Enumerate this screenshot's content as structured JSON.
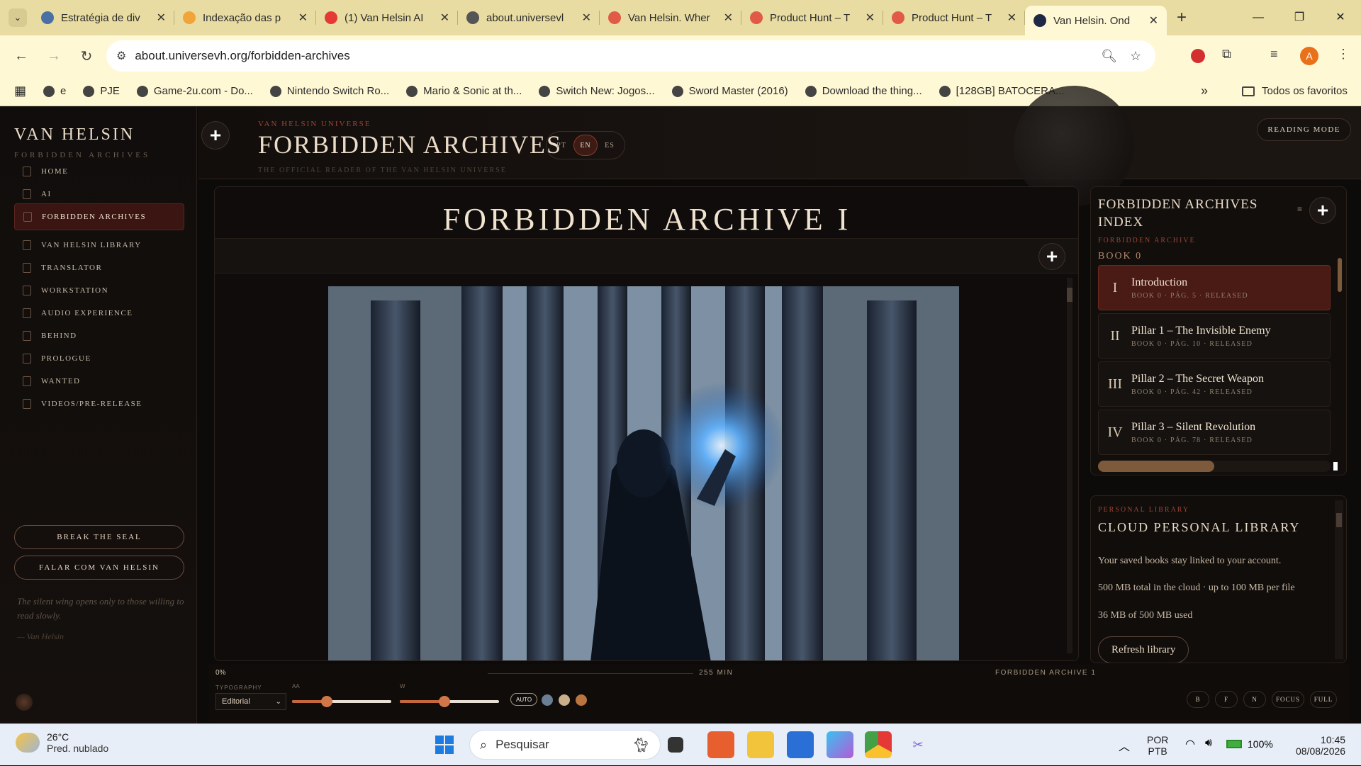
{
  "browser": {
    "tabs": [
      {
        "title": "Estratégia de div",
        "icon": "settings-globe-icon",
        "color": "#4a6fa5"
      },
      {
        "title": "Indexação das p",
        "icon": "analytics-icon",
        "color": "#f2a33a"
      },
      {
        "title": "(1) Van Helsin AI",
        "icon": "youtube-icon",
        "color": "#e53935"
      },
      {
        "title": "about.universevl",
        "icon": "globe-icon",
        "color": "#555555"
      },
      {
        "title": "Van Helsin. Wher",
        "icon": "producthunt-icon",
        "color": "#e05a47"
      },
      {
        "title": "Product Hunt – T",
        "icon": "producthunt-icon",
        "color": "#e05a47"
      },
      {
        "title": "Product Hunt – T",
        "icon": "producthunt-icon",
        "color": "#e05a47"
      },
      {
        "title": "Van Helsin. Ond",
        "icon": "vanhelsin-icon",
        "color": "#1e2a44"
      }
    ],
    "active_tab": 7,
    "url": "about.universevh.org/forbidden-archives",
    "bookmarks": [
      "e",
      "PJE",
      "Game-2u.com - Do...",
      "Nintendo Switch Ro...",
      "Mario & Sonic at th...",
      "Switch New: Jogos...",
      "Sword Master (2016)",
      "Download the thing...",
      "[128GB] BATOCERA..."
    ],
    "all_bookmarks": "Todos os favoritos",
    "profile_initial": "A"
  },
  "sidebar": {
    "brand": "VAN HELSIN",
    "brand_sub": "FORBIDDEN ARCHIVES",
    "items": [
      "HOME",
      "AI",
      "FORBIDDEN ARCHIVES",
      "VAN HELSIN LIBRARY",
      "TRANSLATOR",
      "WORKSTATION",
      "AUDIO EXPERIENCE",
      "BEHIND",
      "PROLOGUE",
      "WANTED",
      "VIDEOS/PRE-RELEASE"
    ],
    "active_index": 2,
    "btn_seal": "BREAK THE SEAL",
    "btn_talk": "FALAR COM VAN HELSIN",
    "quote": "The silent wing opens only to those willing to read slowly.",
    "quote_author": "— Van Helsin"
  },
  "header": {
    "plus": "+",
    "eyebrow": "VAN HELSIN UNIVERSE",
    "title": "FORBIDDEN ARCHIVES",
    "subtitle": "THE OFFICIAL READER OF THE VAN HELSIN UNIVERSE",
    "langs": [
      "PT",
      "EN",
      "ES"
    ],
    "active_lang": "EN",
    "reading_mode": "READING MODE"
  },
  "reader": {
    "title": "FORBIDDEN ARCHIVE I",
    "plus": "+"
  },
  "index": {
    "title": "FORBIDDEN ARCHIVES INDEX",
    "menu": "≡",
    "plus": "+",
    "eyebrow": "FORBIDDEN ARCHIVE",
    "book": "BOOK 0",
    "chapters": [
      {
        "num": "I",
        "title": "Introduction",
        "meta": "BOOK 0 · PÁG. 5 · RELEASED"
      },
      {
        "num": "II",
        "title": "Pillar 1 – The Invisible Enemy",
        "meta": "BOOK 0 · PÁG. 10 · RELEASED"
      },
      {
        "num": "III",
        "title": "Pillar 2 – The Secret Weapon",
        "meta": "BOOK 0 · PÁG. 42 · RELEASED"
      },
      {
        "num": "IV",
        "title": "Pillar 3 – Silent Revolution",
        "meta": "BOOK 0 · PÁG. 78 · RELEASED"
      }
    ]
  },
  "library": {
    "eyebrow": "PERSONAL LIBRARY",
    "title": "CLOUD PERSONAL LIBRARY",
    "line1": "Your saved books stay linked to your account.",
    "line2": "500 MB total in the cloud · up to 100 MB per file",
    "line3": "36 MB of 500 MB used",
    "refresh": "Refresh library"
  },
  "bottombar": {
    "progress": "0%",
    "minutes": "255 MIN",
    "archive": "FORBIDDEN ARCHIVE 1",
    "typography_label": "TYPOGRAPHY",
    "font_select": "Editorial",
    "size_label": "AA",
    "width_label": "W",
    "size_value": 0.35,
    "width_value": 0.45,
    "auto": "AUTO",
    "themes": [
      "#6a7f93",
      "#c9b08a",
      "#b9743f"
    ],
    "modes": [
      "B",
      "F",
      "N",
      "FOCUS",
      "FULL"
    ]
  },
  "taskbar": {
    "temp": "26°C",
    "weather": "Pred. nublado",
    "search": "Pesquisar",
    "lang1": "POR",
    "lang2": "PTB",
    "battery": "100%",
    "time": "10:45",
    "date": "08/08/2026"
  }
}
